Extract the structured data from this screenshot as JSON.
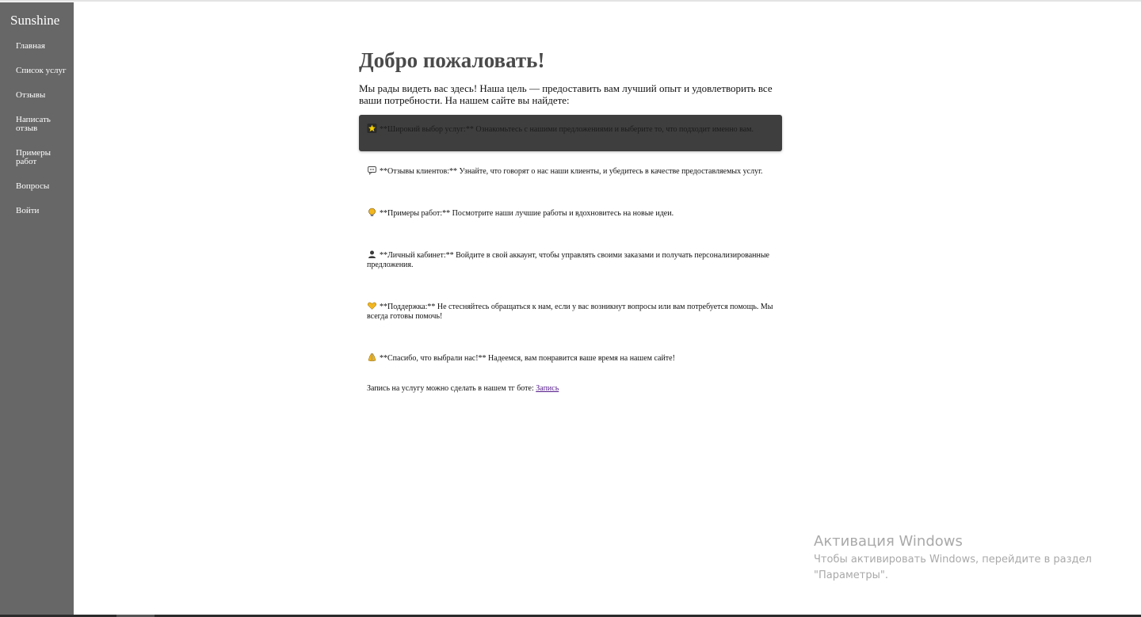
{
  "brand": "Sunshine",
  "nav": [
    {
      "label": "Главная"
    },
    {
      "label": "Список услуг"
    },
    {
      "label": "Отзывы"
    },
    {
      "label": "Написать отзыв"
    },
    {
      "label": "Примеры работ"
    },
    {
      "label": "Вопросы"
    },
    {
      "label": "Войти"
    }
  ],
  "main": {
    "title": "Добро пожаловать!",
    "intro": "Мы рады видеть вас здесь! Наша цель — предоставить вам лучший опыт и удовлетворить все ваши потребности. На нашем сайте вы найдете:",
    "features": [
      {
        "icon": "star-icon",
        "text": "**Широкий выбор услуг:** Ознакомьтесь с нашими предложениями и выберите то, что подходит именно вам."
      },
      {
        "icon": "speech-bubble-icon",
        "text": "**Отзывы клиентов:** Узнайте, что говорят о нас наши клиенты, и убедитесь в качестве предоставляемых услуг."
      },
      {
        "icon": "lightbulb-icon",
        "text": "**Примеры работ:** Посмотрите наши лучшие работы и вдохновитесь на новые идеи."
      },
      {
        "icon": "user-silhouette-icon",
        "text": "**Личный кабинет:** Войдите в свой аккаунт, чтобы управлять своими заказами и получать персонализированные предложения."
      },
      {
        "icon": "heart-icon",
        "text": "**Поддержка:** Не стесняйтесь обращаться к нам, если у вас возникнут вопросы или вам потребуется помощь. Мы всегда готовы помочь!"
      },
      {
        "icon": "praying-hands-icon",
        "text": "**Спасибо, что выбрали нас!** Надеемся, вам понравится ваше время на нашем сайте!"
      }
    ],
    "booking_text": "Запись на услугу можно сделать в нашем тг боте:",
    "booking_link": "Запись"
  },
  "watermark": {
    "title": "Активация Windows",
    "subtitle": "Чтобы активировать Windows, перейдите в раздел \"Параметры\"."
  },
  "colors": {
    "sidebar": "#676767",
    "title": "#4a4a4a",
    "active_feature": "#3e3e3e",
    "link": "#551a8b"
  }
}
